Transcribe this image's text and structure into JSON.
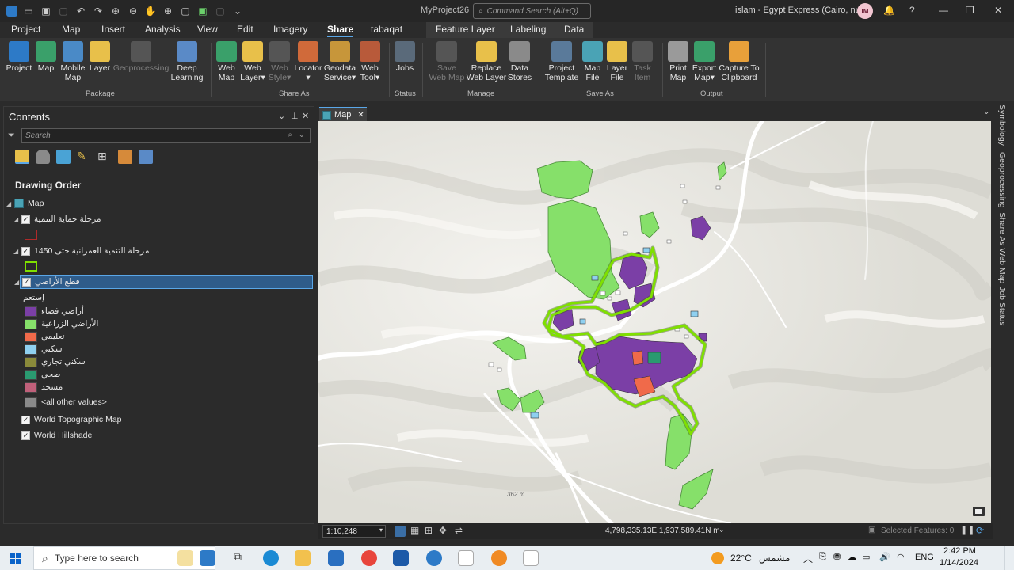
{
  "titlebar": {
    "project": "MyProject26",
    "command_search_placeholder": "Command Search (Alt+Q)",
    "user": "islam - Egypt Express (Cairo, null)",
    "avatar_initials": "IM"
  },
  "menu": {
    "tabs": [
      "Project",
      "Map",
      "Insert",
      "Analysis",
      "View",
      "Edit",
      "Imagery",
      "Share",
      "tabaqat"
    ],
    "active": "Share",
    "context_tabs": [
      "Feature Layer",
      "Labeling",
      "Data"
    ]
  },
  "ribbon": {
    "package": {
      "label": "Package",
      "buttons": [
        {
          "label": "Project",
          "icon": "project-package-icon"
        },
        {
          "label": "Map",
          "icon": "map-package-icon"
        },
        {
          "label": "Mobile\nMap",
          "icon": "mobile-map-icon"
        },
        {
          "label": "Layer",
          "icon": "layer-package-icon"
        },
        {
          "label": "Geoprocessing",
          "icon": "geoprocessing-icon",
          "disabled": true
        },
        {
          "label": "Deep\nLearning",
          "icon": "deep-learning-icon"
        }
      ]
    },
    "share_as": {
      "label": "Share As",
      "buttons": [
        {
          "label": "Web\nMap",
          "icon": "web-map-icon"
        },
        {
          "label": "Web\nLayer▾",
          "icon": "web-layer-icon"
        },
        {
          "label": "Web\nStyle▾",
          "icon": "web-style-icon",
          "disabled": true
        },
        {
          "label": "Locator\n▾",
          "icon": "locator-icon"
        },
        {
          "label": "Geodata\nService▾",
          "icon": "geodata-service-icon"
        },
        {
          "label": "Web\nTool▾",
          "icon": "web-tool-icon"
        }
      ]
    },
    "status": {
      "label": "Status",
      "buttons": [
        {
          "label": "Jobs",
          "icon": "jobs-icon"
        }
      ]
    },
    "manage": {
      "label": "Manage",
      "buttons": [
        {
          "label": "Save\nWeb Map",
          "icon": "save-web-map-icon",
          "disabled": true
        },
        {
          "label": "Replace\nWeb Layer",
          "icon": "replace-web-layer-icon"
        },
        {
          "label": "Data\nStores",
          "icon": "data-stores-icon"
        }
      ]
    },
    "save_as": {
      "label": "Save As",
      "buttons": [
        {
          "label": "Project\nTemplate",
          "icon": "project-template-icon"
        },
        {
          "label": "Map\nFile",
          "icon": "map-file-icon"
        },
        {
          "label": "Layer\nFile",
          "icon": "layer-file-icon"
        },
        {
          "label": "Task\nItem",
          "icon": "task-item-icon",
          "disabled": true
        }
      ]
    },
    "output": {
      "label": "Output",
      "buttons": [
        {
          "label": "Print\nMap",
          "icon": "print-map-icon"
        },
        {
          "label": "Export\nMap▾",
          "icon": "export-map-icon"
        },
        {
          "label": "Capture To\nClipboard",
          "icon": "capture-clipboard-icon"
        }
      ]
    }
  },
  "contents": {
    "title": "Contents",
    "search_placeholder": "Search",
    "drawing_order": "Drawing Order",
    "map_node": "Map",
    "layers": [
      {
        "name": "مرحلة حماية التنمية",
        "checked": true,
        "symbol": {
          "fill": "none",
          "outline": "#b02a2a"
        }
      },
      {
        "name": "مرحلة التنمية العمرانية حتى 1450",
        "checked": true,
        "symbol": {
          "fill": "none",
          "outline": "#7fe000"
        }
      },
      {
        "name": "قطع الأراضي",
        "checked": true,
        "selected": true,
        "field": "إستعم",
        "legend": [
          {
            "label": "أراضي فضاء",
            "color": "#7b3fa6"
          },
          {
            "label": "الأراضي الزراعية",
            "color": "#86e06a"
          },
          {
            "label": "تعليمي",
            "color": "#f06a4a"
          },
          {
            "label": "سكني",
            "color": "#8fd0f0"
          },
          {
            "label": "سكني تجاري",
            "color": "#8a8a3a"
          },
          {
            "label": "صحي",
            "color": "#2a9a70"
          },
          {
            "label": "مسجد",
            "color": "#c0607a"
          },
          {
            "label": "<all other values>",
            "color": "#8a8a8a"
          }
        ]
      },
      {
        "name": "World Topographic Map",
        "checked": true
      },
      {
        "name": "World Hillshade",
        "checked": true
      }
    ]
  },
  "map": {
    "tab_label": "Map",
    "scale": "1:10,248",
    "coordinates": "4,798,335.13E 1,937,589.41N m",
    "selected_features": "Selected Features: 0",
    "elevation_label": "362 m"
  },
  "side_tabs": [
    "Symbology",
    "Geoprocessing",
    "Share As Web Map",
    "Job Status"
  ],
  "taskbar": {
    "search_placeholder": "Type here to search",
    "weather_temp": "22°C",
    "weather_text": "مشمس",
    "language": "ENG",
    "time": "2:42 PM",
    "date": "1/14/2024"
  }
}
